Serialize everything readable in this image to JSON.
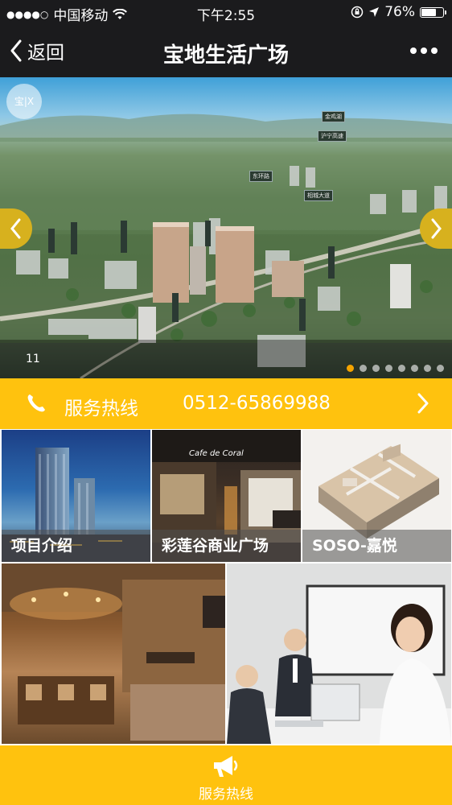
{
  "status_bar": {
    "carrier": "中国移动",
    "time": "下午2:55",
    "battery": "76%",
    "battery_level": 0.76,
    "signal_dots": "●●●●○"
  },
  "nav": {
    "back_label": "返回",
    "title": "宝地生活广场"
  },
  "banner": {
    "counter": "11",
    "logo_text": "宝|X",
    "slides": 8,
    "active_slide": 0,
    "tags": [
      "金鸡湖",
      "沪宁高速",
      "东环路",
      "相城大道"
    ]
  },
  "hotline": {
    "label": "服务热线",
    "number": "0512-65869988"
  },
  "tiles": [
    {
      "caption": "项目介绍"
    },
    {
      "caption": "彩莲谷商业广场"
    },
    {
      "caption": "SOSO-嘉悦"
    },
    {
      "caption": ""
    },
    {
      "caption": ""
    }
  ],
  "mall_sign": "Cafe de Coral",
  "bottom_bar": {
    "label": "服务热线"
  },
  "colors": {
    "accent": "#ffc20e",
    "nav_bg": "#1b1b1d",
    "active_dot": "#f5a400"
  }
}
